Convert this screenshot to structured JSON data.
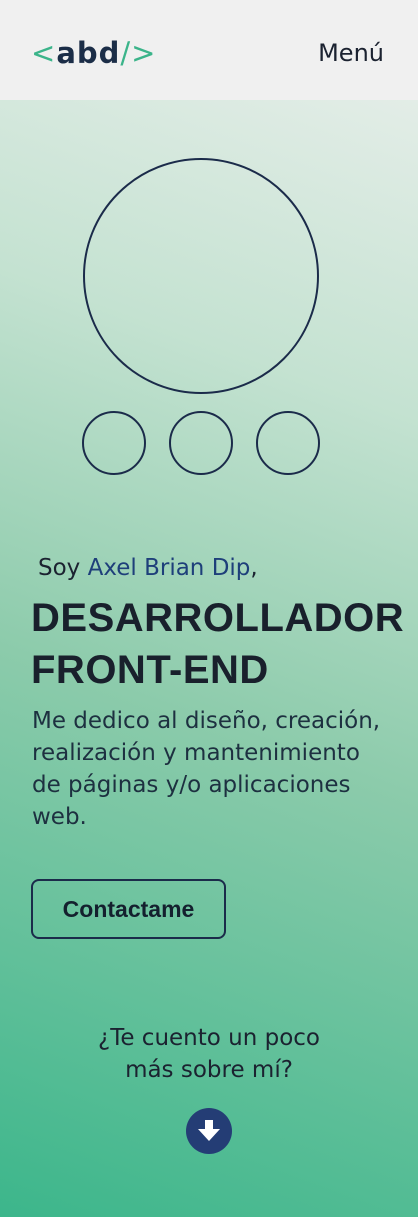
{
  "header": {
    "logo": {
      "open": "<",
      "text": "abd",
      "close": "/>"
    },
    "menu_label": "Menú"
  },
  "hero": {
    "greeting_prefix": "Soy ",
    "name": "Axel Brian Dip",
    "greeting_suffix": ",",
    "title_line1": "DESARROLLADOR",
    "title_line2": "FRONT-END",
    "description": "Me dedico al diseño, creación, realización y mantenimiento de páginas y/o aplicaciones web.",
    "cta_label": "Contactame",
    "more_line1": "¿Te cuento un poco",
    "more_line2": "más sobre mí?",
    "scroll_icon": "arrow-down-icon"
  },
  "colors": {
    "accent": "#3bb48a",
    "navy": "#243d75",
    "name_color": "#1e3f7a"
  }
}
